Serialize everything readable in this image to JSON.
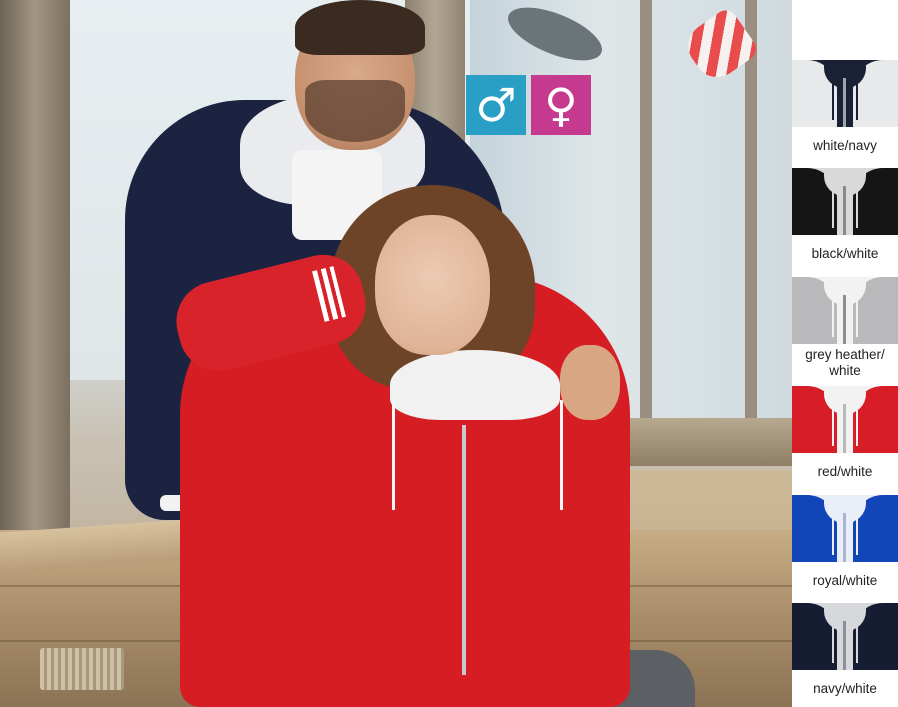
{
  "gender_icons": {
    "male": {
      "symbol": "♂",
      "icon": "male-symbol-icon",
      "color": "#2a9fc6"
    },
    "female": {
      "symbol": "♀",
      "icon": "female-symbol-icon",
      "color": "#c53a8e"
    }
  },
  "colors": [
    {
      "label": "white/navy",
      "body": "#e8e9eb",
      "inner": "#1a2035",
      "zip": "#9fa3ab"
    },
    {
      "label": "black/white",
      "body": "#151515",
      "inner": "#d9d9d9",
      "zip": "#8a8a8a"
    },
    {
      "label": "grey heather/ white",
      "body": "#b9b9bb",
      "inner": "#f2f2f2",
      "zip": "#8f8f8f"
    },
    {
      "label": "red/white",
      "body": "#d71e26",
      "inner": "#f2f2f2",
      "zip": "#b8b8b8"
    },
    {
      "label": "royal/white",
      "body": "#1246b8",
      "inner": "#e9eef7",
      "zip": "#a8b4d2"
    },
    {
      "label": "navy/white",
      "body": "#161c31",
      "inner": "#d6d8dc",
      "zip": "#8c8f98"
    }
  ]
}
